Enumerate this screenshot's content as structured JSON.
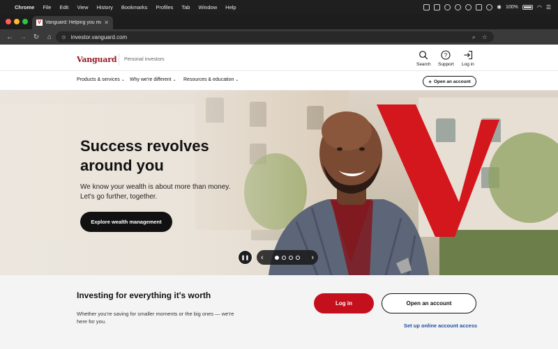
{
  "menubar": {
    "items": [
      "Chrome",
      "File",
      "Edit",
      "View",
      "History",
      "Bookmarks",
      "Profiles",
      "Tab",
      "Window",
      "Help"
    ],
    "battery_label": "100%"
  },
  "browser": {
    "tab_title": "Vanguard: Helping you reach",
    "favicon_letter": "V",
    "url": "investor.vanguard.com"
  },
  "header": {
    "logo": "Vanguard",
    "subbrand": "Personal investors",
    "search_label": "Search",
    "support_label": "Support",
    "login_label": "Log in"
  },
  "nav": {
    "items": [
      "Products & services",
      "Why we're different",
      "Resources & education"
    ],
    "open_account": "Open an account"
  },
  "hero": {
    "title": "Success revolves around you",
    "subtitle": "We know your wealth is about more than money. Let's go further, together.",
    "cta": "Explore wealth management",
    "slides": 4,
    "active_slide": 1
  },
  "bottom": {
    "title": "Investing for everything it's worth",
    "text": "Whether you're saving for smaller moments or the big ones — we're here for you.",
    "login_button": "Log in",
    "open_button": "Open an account",
    "setup_link": "Set up online account access"
  },
  "colors": {
    "brand_red": "#96151d",
    "cta_red": "#c4101c",
    "link_blue": "#1b4fa3"
  }
}
